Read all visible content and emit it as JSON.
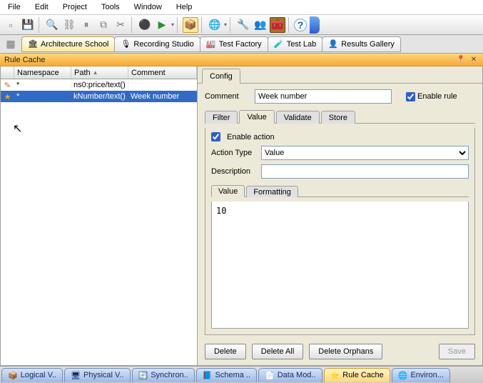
{
  "menu": {
    "items": [
      "File",
      "Edit",
      "Project",
      "Tools",
      "Window",
      "Help"
    ]
  },
  "perspectives": {
    "items": [
      {
        "label": "Architecture School",
        "icon": "🏛"
      },
      {
        "label": "Recording Studio",
        "icon": "🎙"
      },
      {
        "label": "Test Factory",
        "icon": "🏭"
      },
      {
        "label": "Test Lab",
        "icon": "🧪"
      },
      {
        "label": "Results Gallery",
        "icon": "👤"
      }
    ],
    "active": 0
  },
  "panel": {
    "title": "Rule Cache"
  },
  "table": {
    "headers": {
      "ns": "Namespace",
      "path": "Path",
      "comment": "Comment"
    },
    "sort_col": "path",
    "rows": [
      {
        "icon": "pencil",
        "ns": "*",
        "path": "ns0:price/text()",
        "comment": ""
      },
      {
        "icon": "star",
        "ns": "*",
        "path": "kNumber/text()",
        "comment": "Week number",
        "selected": true
      }
    ]
  },
  "config": {
    "tab_label": "Config",
    "comment_label": "Comment",
    "comment_value": "Week number",
    "enable_rule_label": "Enable rule",
    "enable_rule": true,
    "subtabs": [
      "Filter",
      "Value",
      "Validate",
      "Store"
    ],
    "subtab_active": 1,
    "enable_action_label": "Enable action",
    "enable_action": true,
    "action_type_label": "Action Type",
    "action_type_value": "Value",
    "description_label": "Description",
    "description_value": "",
    "value_tabs": [
      "Value",
      "Formatting"
    ],
    "value_tab_active": 0,
    "value_text": "10",
    "buttons": {
      "delete": "Delete",
      "delete_all": "Delete All",
      "delete_orphans": "Delete Orphans",
      "save": "Save"
    }
  },
  "bottom_tabs": [
    {
      "label": "Logical V..",
      "icon": "📦"
    },
    {
      "label": "Physical V..",
      "icon": "🖥"
    },
    {
      "label": "Synchron..",
      "icon": "🔄"
    },
    {
      "label": "Schema ..",
      "icon": "📘"
    },
    {
      "label": "Data Mod..",
      "icon": "📄"
    },
    {
      "label": "Rule Cache",
      "icon": "⭐",
      "active": true
    },
    {
      "label": "Environ...",
      "icon": "🌐"
    }
  ]
}
